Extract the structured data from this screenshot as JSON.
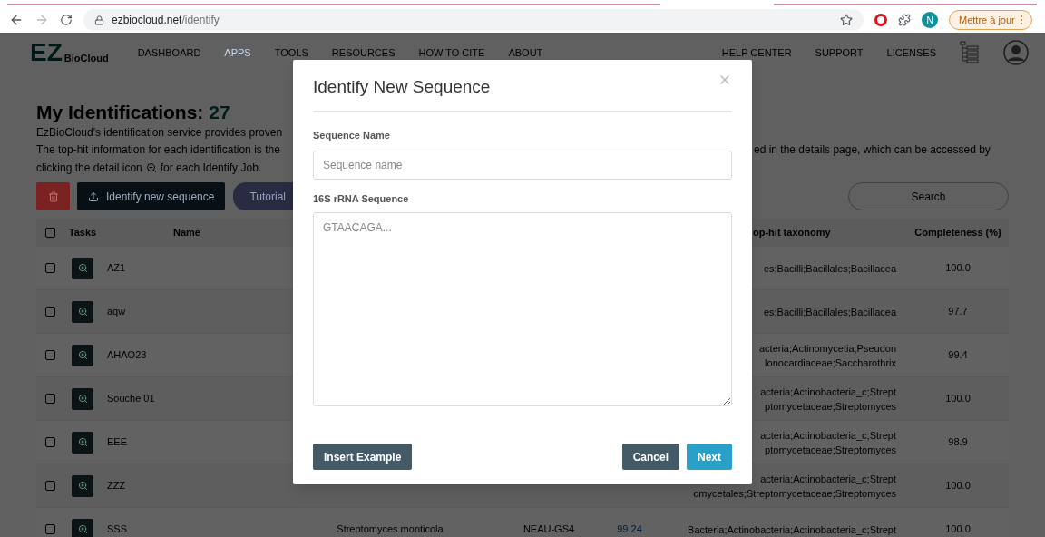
{
  "browser": {
    "url_host": "ezbiocloud.net",
    "url_path": "/identify",
    "avatar_letter": "N",
    "update_button": "Mettre à jour"
  },
  "header": {
    "logo_big": "EZ",
    "logo_small": "BioCloud",
    "nav": [
      {
        "label": "DASHBOARD",
        "selected": false
      },
      {
        "label": "APPS",
        "selected": true
      },
      {
        "label": "TOOLS",
        "selected": false
      },
      {
        "label": "RESOURCES",
        "selected": false
      },
      {
        "label": "HOW TO CITE",
        "selected": false
      },
      {
        "label": "ABOUT",
        "selected": false
      }
    ],
    "nav_right": [
      "HELP CENTER",
      "SUPPORT",
      "LICENSES"
    ]
  },
  "page": {
    "title": "My Identifications:",
    "count": "27",
    "description_left": [
      "EzBioCloud's identification service provides proven",
      "The top-hit information for each identification is the"
    ],
    "description_right": "ed in the details page, which can be accessed by",
    "description_line3_before": "clicking the detail icon",
    "description_line3_after": "for each Identify Job.",
    "identify_button": "Identify new sequence",
    "tutorial": "Tutorial",
    "search_placeholder": "Search"
  },
  "table": {
    "header_checked": false,
    "columns": [
      "Tasks",
      "Name",
      "op-hit taxonomy",
      "Completeness (%)"
    ],
    "rows": [
      {
        "checked": false,
        "name": "AZ1",
        "taxonomy": [
          "es;Bacilli;Bacillales;Bacillacea"
        ],
        "completeness": "100.0"
      },
      {
        "checked": false,
        "name": "aqw",
        "taxonomy": [
          "es;Bacilli;Bacillales;Bacillacea"
        ],
        "completeness": "97.7"
      },
      {
        "checked": false,
        "name": "AHAO23",
        "taxonomy": [
          "acteria;Actinomycetia;Pseudon",
          "lonocardiaceae;Saccharothrix"
        ],
        "completeness": "99.4"
      },
      {
        "checked": false,
        "name": "Souche 01",
        "taxonomy": [
          "acteria;Actinobacteria_c;Strept",
          "ptomycetaceae;Streptomyces"
        ],
        "completeness": "100.0"
      },
      {
        "checked": false,
        "name": "EEE",
        "taxonomy": [
          "acteria;Actinobacteria_c;Strept",
          "ptomycetaceae;Streptomyces"
        ],
        "completeness": "98.9"
      },
      {
        "checked": false,
        "name": "ZZZ",
        "taxonomy": [
          "acteria;Actinobacteria_c;Strept",
          "omycetales;Streptomycetaceae;Streptomyces"
        ],
        "completeness": "100.0"
      },
      {
        "checked": false,
        "name": "SSS",
        "top_hit": "Streptomyces monticola",
        "strain": "NEAU-GS4",
        "similarity": "99.24",
        "taxonomy": [
          "Bacteria;Actinobacteria;Actinobacteria_c;Strept"
        ],
        "completeness": "100.0"
      }
    ]
  },
  "modal": {
    "title": "Identify New Sequence",
    "name_label": "Sequence Name",
    "name_placeholder": "Sequence name",
    "sequence_label": "16S rRNA Sequence",
    "sequence_placeholder": "GTAACAGA...",
    "insert_button": "Insert Example",
    "cancel_button": "Cancel",
    "next_button": "Next"
  }
}
